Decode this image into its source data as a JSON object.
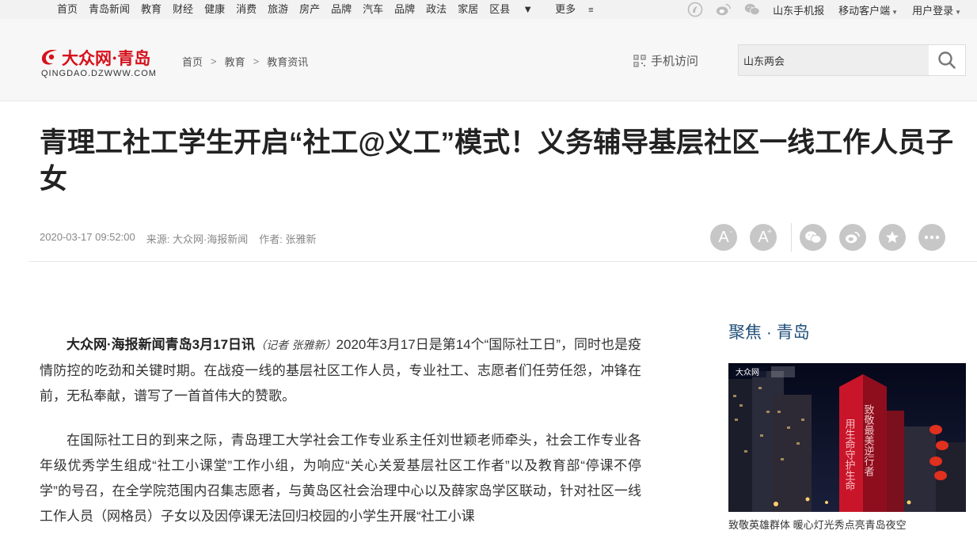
{
  "topnav": {
    "items": [
      "首页",
      "青岛新闻",
      "教育",
      "财经",
      "健康",
      "消费",
      "旅游",
      "房产",
      "品牌",
      "汽车",
      "品牌",
      "政法",
      "家居",
      "区县",
      "更多"
    ],
    "right_links": [
      "山东手机报",
      "移动客户端",
      "用户登录"
    ],
    "icons": [
      "app-icon",
      "weibo-icon",
      "wechat-icon"
    ]
  },
  "header": {
    "logo_text": "大众网·青岛",
    "logo_sub": "QINGDAO.DZWWW.COM",
    "breadcrumb": [
      "首页",
      "教育",
      "教育资讯"
    ],
    "mobile_visit": "手机访问",
    "search_value": "山东两会"
  },
  "article": {
    "title": "青理工社工学生开启“社工@义工”模式！义务辅导基层社区一线工作人员子女",
    "date": "2020-03-17 09:52:00",
    "source": "来源: 大众网·海报新闻",
    "author": "作者: 张雅新",
    "p1_lead": "大众网·海报新闻青岛3月17日讯",
    "p1_reporter": "（记者 张雅新）",
    "p1_body": "2020年3月17日是第14个“国际社工日”，同时也是疫情防控的吃劲和关键时期。在战疫一线的基层社区工作人员，专业社工、志愿者们任劳任怨，冲锋在前，无私奉献，谱写了一首首伟大的赞歌。",
    "p2": "在国际社工日的到来之际，青岛理工大学社会工作专业系主任刘世颖老师牵头，社会工作专业各年级优秀学生组成“社工小课堂”工作小组，为响应“关心关爱基层社区工作者”以及教育部“停课不停学”的号召，在全学院范围内召集志愿者，与黄岛区社会治理中心以及薛家岛学区联动，针对社区一线工作人员（网格员）子女以及因停课无法回归校园的小学生开展“社工小课"
  },
  "tools": {
    "font_small": "A",
    "font_small_sup": "-",
    "font_large": "A",
    "font_large_sup": "+",
    "share_icons": [
      "wechat-share-icon",
      "weibo-share-icon",
      "favorite-star-icon",
      "more-icon"
    ]
  },
  "sidebar": {
    "focus_title": "聚焦 · 青岛",
    "focus_caption": "致敬英雄群体 暖心灯光秀点亮青岛夜空"
  },
  "colors": {
    "logo_red": "#d6121c",
    "focus_blue": "#1f4e79",
    "tool_gray": "#c7c7c7"
  }
}
